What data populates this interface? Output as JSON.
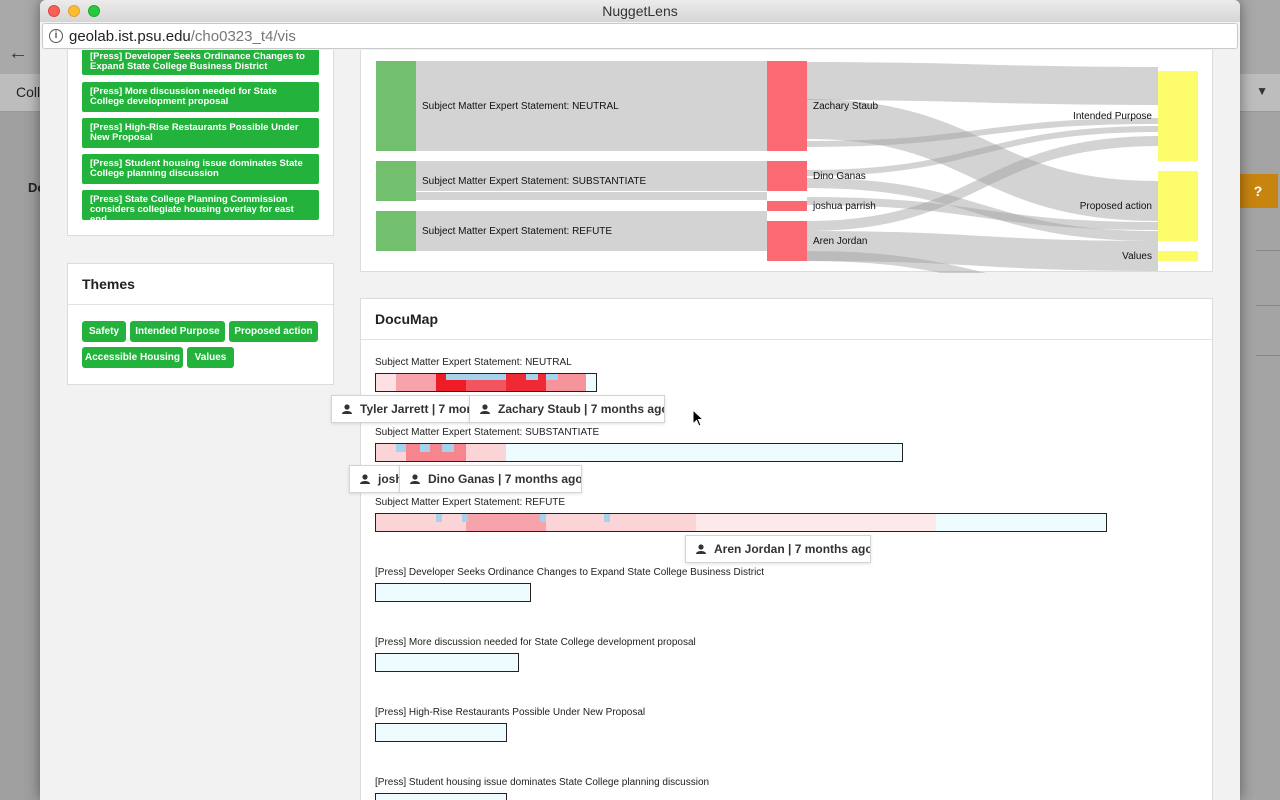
{
  "window": {
    "title": "NuggetLens",
    "url_host": "geolab.ist.psu.edu",
    "url_path": "/cho0323_t4/vis"
  },
  "background": {
    "nav_text": "Coll",
    "side_text": "Do",
    "help_label": "?"
  },
  "nuggets": [
    "[Press] Developer Seeks Ordinance Changes to Expand State College Business District",
    "[Press] More discussion needed for State College development proposal",
    "[Press] High-Rise Restaurants Possible Under New Proposal",
    "[Press] Student housing issue dominates State College planning discussion",
    "[Press] State College Planning Commission considers collegiate housing overlay for east end"
  ],
  "themes": {
    "title": "Themes",
    "items": [
      "Safety",
      "Intended Purpose",
      "Proposed action",
      "Accessible Housing",
      "Values"
    ]
  },
  "sankey": {
    "sources": [
      "Subject Matter Expert Statement: NEUTRAL",
      "Subject Matter Expert Statement: SUBSTANTIATE",
      "Subject Matter Expert Statement: REFUTE"
    ],
    "people": [
      "Zachary Staub",
      "Dino Ganas",
      "joshua parrish",
      "Aren Jordan"
    ],
    "themes": [
      "Intended Purpose",
      "Proposed action",
      "Values"
    ],
    "colors": {
      "source": "#72bf6e",
      "person": "#fb6a73",
      "theme": "#fdfc6a",
      "link": "#bdbdbd"
    }
  },
  "documap": {
    "title": "DocuMap",
    "rows": [
      "Subject Matter Expert Statement: NEUTRAL",
      "Subject Matter Expert Statement: SUBSTANTIATE",
      "Subject Matter Expert Statement: REFUTE",
      "[Press] Developer Seeks Ordinance Changes to Expand State College Business District",
      "[Press] More discussion needed for State College development proposal",
      "[Press] High-Rise Restaurants Possible Under New Proposal",
      "[Press] Student housing issue dominates State College planning discussion"
    ],
    "tooltips": [
      "Tyler Jarrett | 7 months ago",
      "Zachary Staub | 7 months ago",
      "joshua parrish | 7 months ago",
      "Dino Ganas | 7 months ago",
      "Aren Jordan | 7 months ago"
    ]
  }
}
